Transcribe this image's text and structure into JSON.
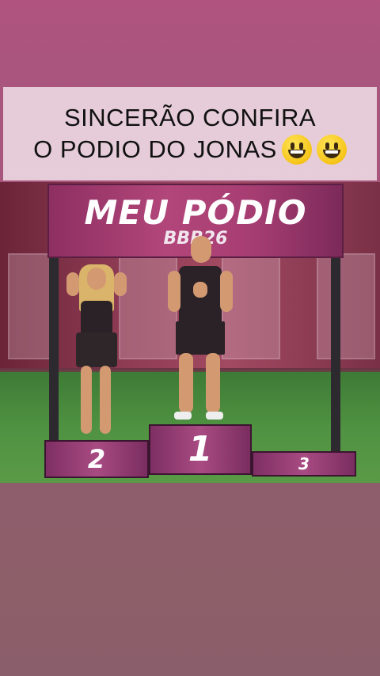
{
  "caption": {
    "line1": "SINCERÃO CONFIRA",
    "line2": "O PODIO DO JONAS",
    "emojis": [
      "smiley-icon",
      "smiley-icon"
    ]
  },
  "banner": {
    "title": "MEU PÓDIO",
    "subtitle": "BBB26"
  },
  "podium": {
    "first": "1",
    "second": "2",
    "third": "3"
  },
  "colors": {
    "top_background": "#b0547f",
    "bottom_background": "#8d5f69",
    "caption_box": "#ebd7e0",
    "podium_block": "#a84b82"
  }
}
